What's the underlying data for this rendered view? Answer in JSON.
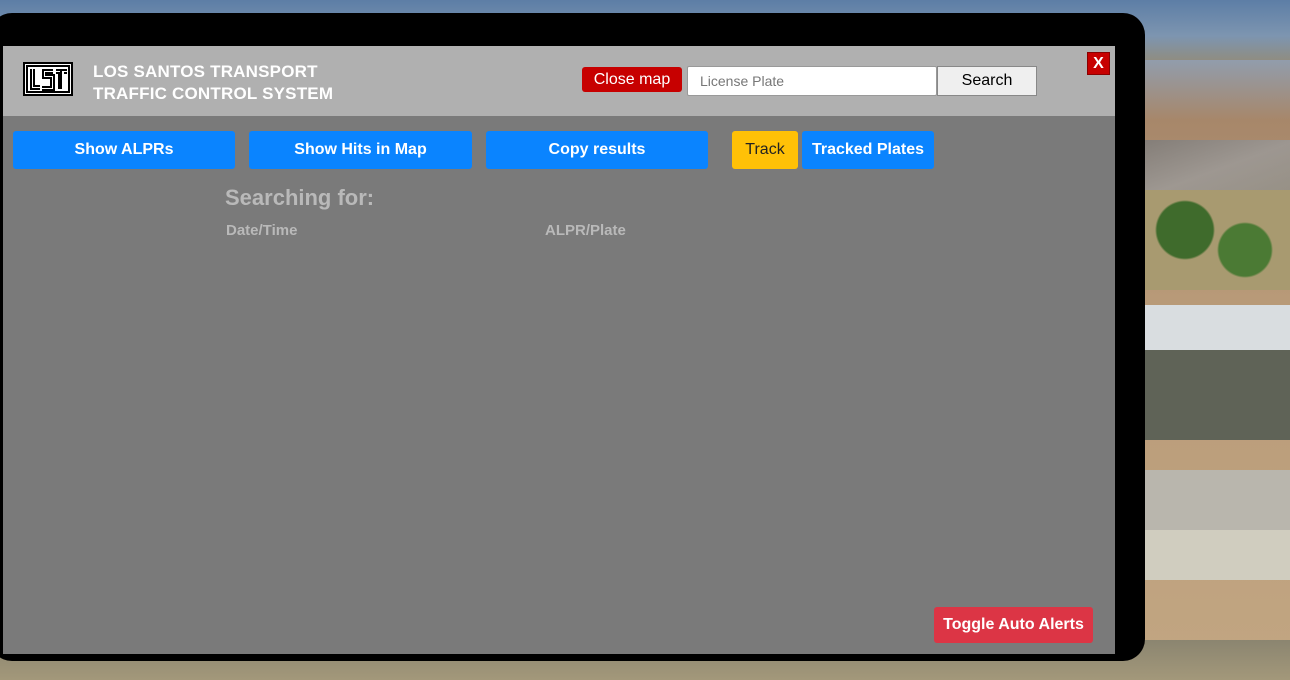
{
  "header": {
    "title_line1": "LOS SANTOS TRANSPORT",
    "title_line2": "TRAFFIC CONTROL SYSTEM",
    "logo_icon": "lst-logo-icon"
  },
  "search": {
    "close_map_label": "Close map",
    "placeholder": "License Plate",
    "value": "",
    "search_label": "Search"
  },
  "window": {
    "close_label": "X"
  },
  "actions": {
    "show_alprs": "Show ALPRs",
    "show_hits": "Show Hits in Map",
    "copy_results": "Copy results",
    "track": "Track",
    "tracked_plates": "Tracked Plates"
  },
  "results": {
    "searching_for_label": "Searching for:",
    "columns": [
      "Date/Time",
      "ALPR/Plate"
    ],
    "rows": []
  },
  "footer": {
    "toggle_auto_alerts": "Toggle Auto Alerts"
  },
  "colors": {
    "primary_blue": "#0a84ff",
    "track_yellow": "#ffc107",
    "close_red": "#c70000",
    "alert_red": "#dc3545",
    "panel_gray": "#7a7a7a",
    "header_gray": "#b0b0b0"
  }
}
